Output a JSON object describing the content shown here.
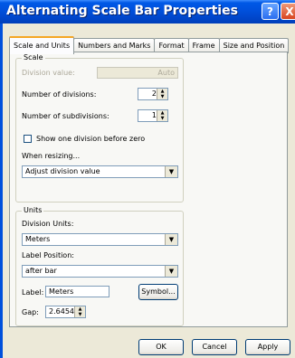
{
  "window": {
    "title": "Alternating Scale Bar Properties"
  },
  "title_buttons": {
    "help": "?",
    "close": "X"
  },
  "tabs": [
    {
      "label": "Scale and Units"
    },
    {
      "label": "Numbers and Marks"
    },
    {
      "label": "Format"
    },
    {
      "label": "Frame"
    },
    {
      "label": "Size and Position"
    }
  ],
  "scale": {
    "group_label": "Scale",
    "division_value_label": "Division value:",
    "division_value": "Auto",
    "num_divisions_label": "Number of divisions:",
    "num_divisions": "2",
    "num_subdivisions_label": "Number of subdivisions:",
    "num_subdivisions": "1",
    "show_one_division_label": "Show one division before zero",
    "show_one_division_checked": false,
    "when_resizing_label": "When resizing...",
    "when_resizing_value": "Adjust division value"
  },
  "units": {
    "group_label": "Units",
    "division_units_label": "Division Units:",
    "division_units_value": "Meters",
    "label_position_label": "Label Position:",
    "label_position_value": "after bar",
    "label_label": "Label:",
    "label_value": "Meters",
    "symbol_button": "Symbol...",
    "gap_label": "Gap:",
    "gap_value": "2.6454"
  },
  "footer": {
    "ok": "OK",
    "cancel": "Cancel",
    "apply": "Apply"
  }
}
